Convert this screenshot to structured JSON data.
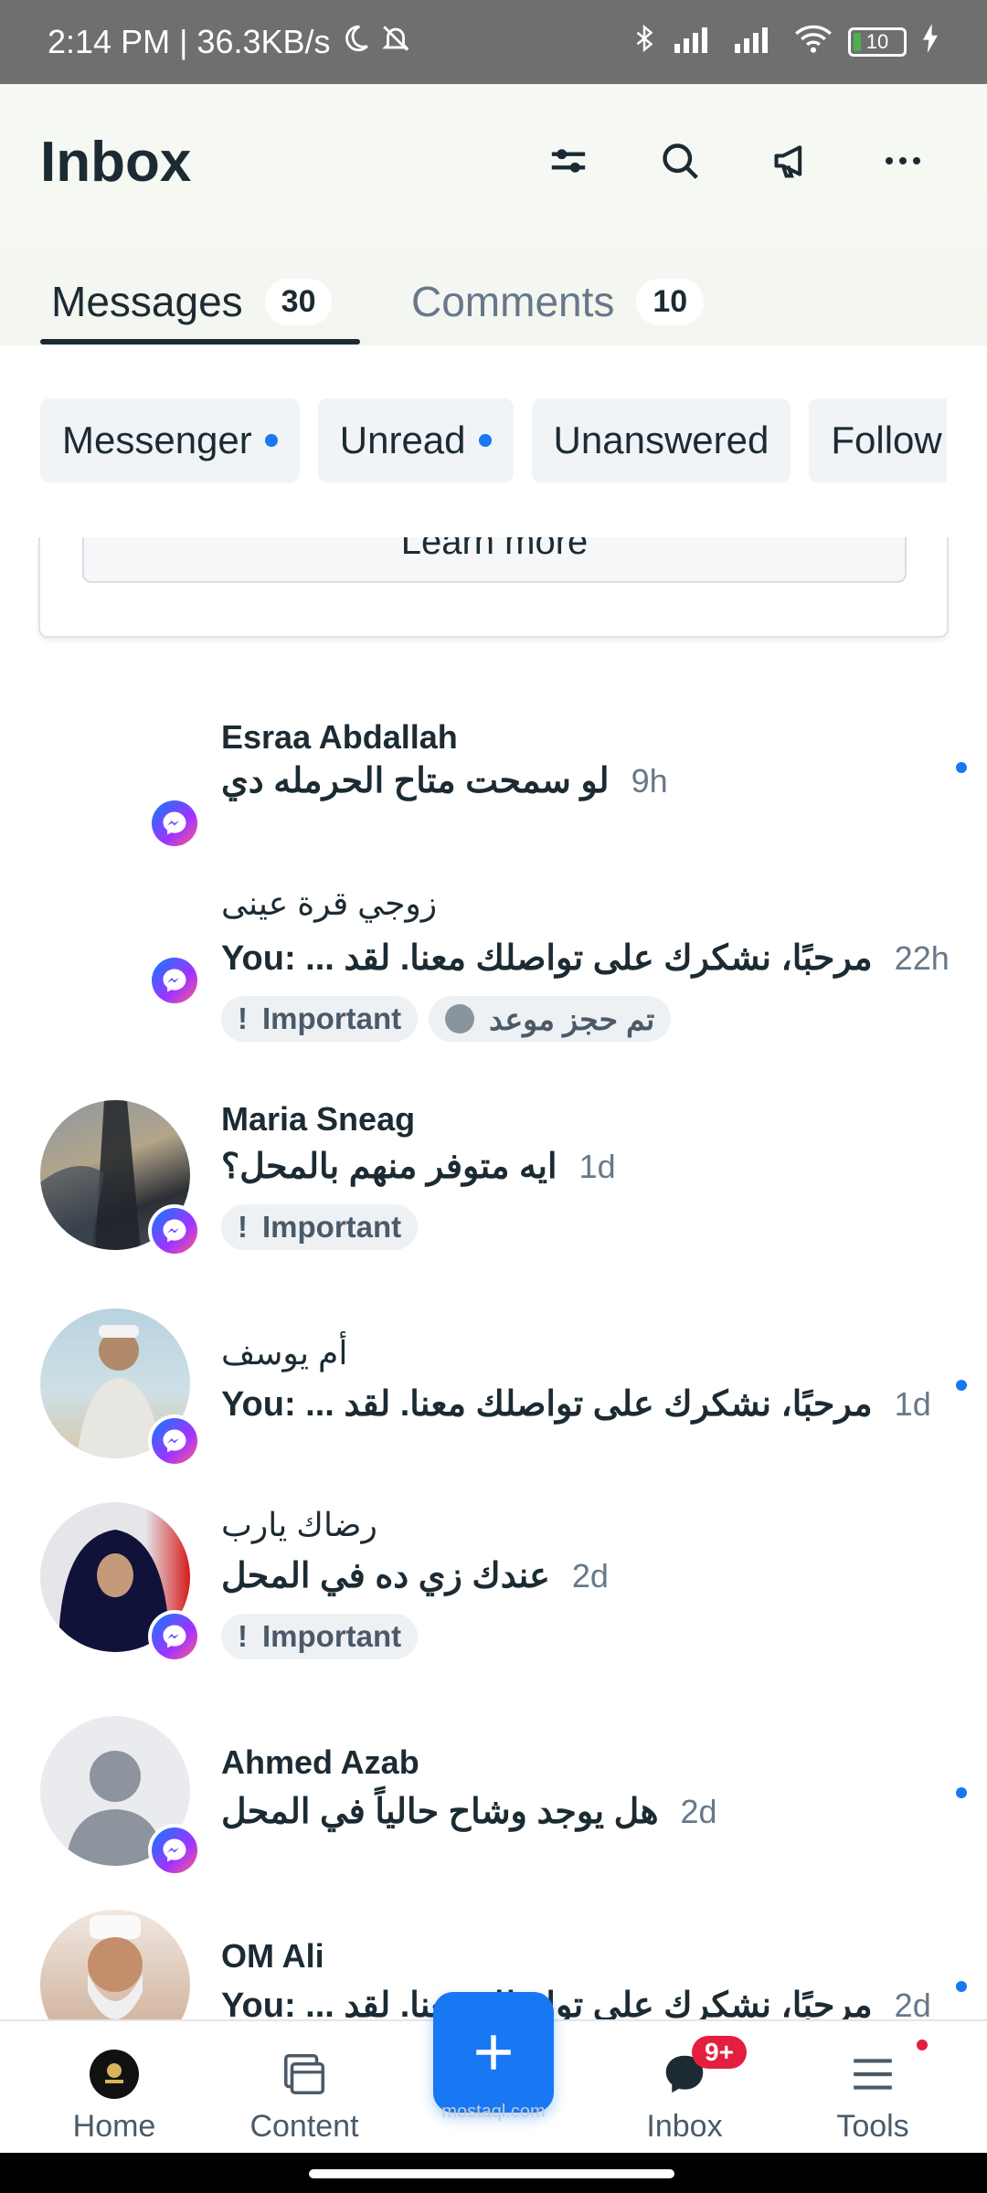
{
  "status_bar": {
    "time_speed": "2:14 PM | 36.3KB/s",
    "battery": "10"
  },
  "header": {
    "title": "Inbox",
    "icons": [
      "filter-icon",
      "search-icon",
      "megaphone-icon",
      "more-icon"
    ]
  },
  "tabs": [
    {
      "label": "Messages",
      "count": "30",
      "active": true
    },
    {
      "label": "Comments",
      "count": "10",
      "active": false
    }
  ],
  "filters": [
    {
      "label": "Messenger",
      "dot": true
    },
    {
      "label": "Unread",
      "dot": true
    },
    {
      "label": "Unanswered",
      "dot": false
    },
    {
      "label": "Follow",
      "dot": false
    }
  ],
  "card": {
    "learn_more": "Learn more"
  },
  "messages": [
    {
      "name": "Esraa Abdallah",
      "preview": "لو سمحت متاح الحرمله دي",
      "time": "9h",
      "unread": true
    },
    {
      "name": "زوجي قرة عينى",
      "preview": "You: ... مرحبًا، نشكرك على تواصلك معنا. لقد",
      "time": "22h",
      "unread": false,
      "tags": [
        "Important",
        "تم حجز موعد"
      ]
    },
    {
      "name": "Maria Sneag",
      "preview": "ايه متوفر منهم بالمحل؟",
      "time": "1d",
      "unread": false,
      "tags": [
        "Important"
      ]
    },
    {
      "name": "أم يوسف",
      "preview": "You: ... مرحبًا، نشكرك على تواصلك معنا. لقد",
      "time": "1d",
      "unread": true
    },
    {
      "name": "رضاك يارب",
      "preview": "عندك زي ده في المحل",
      "time": "2d",
      "unread": false,
      "tags": [
        "Important"
      ]
    },
    {
      "name": "Ahmed Azab",
      "preview": "هل يوجد وشاح حالياً في المحل",
      "time": "2d",
      "unread": true
    },
    {
      "name": "OM Ali",
      "preview": "You: ... مرحبًا، نشكرك على تواصلك معنا. لقد",
      "time": "2d",
      "unread": true
    }
  ],
  "tag_important_prefix": "!",
  "bottom_nav": {
    "home": "Home",
    "content": "Content",
    "inbox": "Inbox",
    "inbox_badge": "9+",
    "tools": "Tools"
  },
  "watermark": "mostaql.com",
  "colors": {
    "accent": "#1877f2",
    "text": "#1c2b33",
    "muted": "#67788a",
    "badge_red": "#e41e3f"
  }
}
